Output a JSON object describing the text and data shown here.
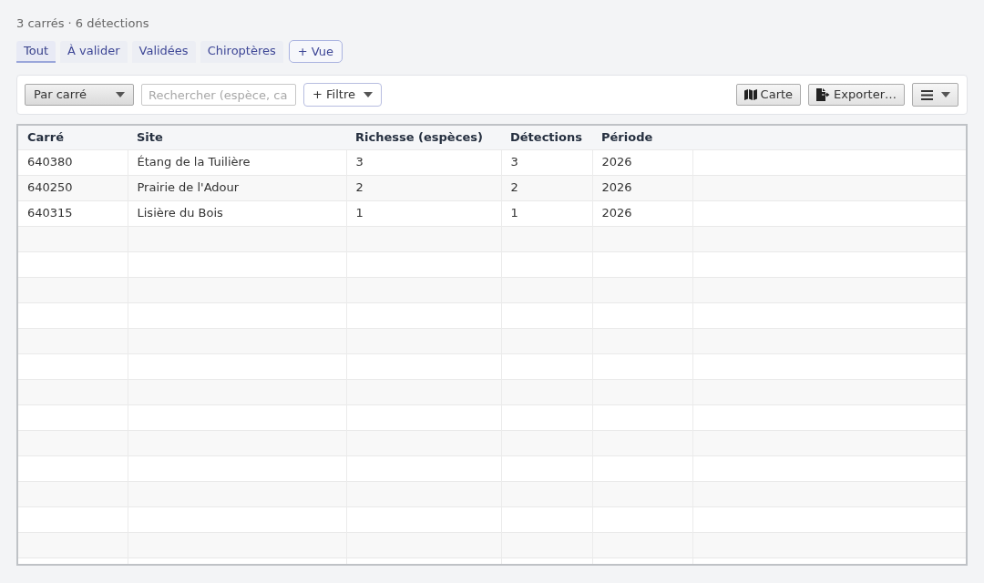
{
  "summary": "3 carrés · 6 détections",
  "tabs": [
    {
      "label": "Tout",
      "selected": true
    },
    {
      "label": "À valider",
      "selected": false
    },
    {
      "label": "Validées",
      "selected": false
    },
    {
      "label": "Chiroptères",
      "selected": false
    }
  ],
  "add_view_button": "+ Vue",
  "toolbar": {
    "group_by": {
      "value": "Par carré"
    },
    "search": {
      "placeholder": "Rechercher (espèce, ca"
    },
    "filter_button": "+ Filtre",
    "map_button": "Carte",
    "export_button": "Exporter…"
  },
  "table": {
    "columns": [
      "Carré",
      "Site",
      "Richesse (espèces)",
      "Détections",
      "Période"
    ],
    "rows": [
      [
        "640380",
        "Étang de la Tuilière",
        "3",
        "3",
        "2026"
      ],
      [
        "640250",
        "Prairie de l'Adour",
        "2",
        "2",
        "2026"
      ],
      [
        "640315",
        "Lisière du Bois",
        "1",
        "1",
        "2026"
      ]
    ]
  }
}
